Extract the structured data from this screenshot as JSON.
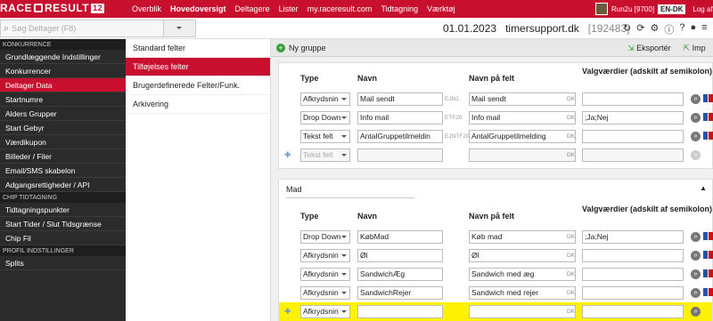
{
  "app": {
    "logo_text": "RACE",
    "logo_result": "RESULT",
    "logo_num": "12"
  },
  "nav": {
    "items": [
      "Overblik",
      "Hovedoversigt",
      "Deltagere",
      "Lister",
      "my.raceresult.com",
      "Tidtagning",
      "Værktøj"
    ],
    "active": "Hovedoversigt"
  },
  "user": {
    "name": "Run2u [9700]",
    "lang": "EN-DK",
    "logout": "Log af"
  },
  "search": {
    "placeholder": "Søg Deltager (F8)"
  },
  "event": {
    "date": "01.01.2023",
    "name": "timersupport.dk",
    "id": "[192483]"
  },
  "sidebar": {
    "sections": [
      {
        "title": "KONKURRENCE",
        "items": [
          "Grundlæggende Indstillinger",
          "Konkurrencer",
          "Deltager Data",
          "Startnumre",
          "Alders Grupper",
          "Start Gebyr",
          "Værdikupon",
          "Billeder / Filer",
          "Email/SMS skabelon",
          "Adgangsrettigheder / API"
        ]
      },
      {
        "title": "CHIP TIDTAGNING",
        "items": [
          "Tidtagningspunkter",
          "Start Tider / Slut Tidsgrænse",
          "Chip Fil"
        ]
      },
      {
        "title": "PROFIL INDSTILLINGER",
        "items": [
          "Splits"
        ]
      }
    ],
    "active": "Deltager Data"
  },
  "midmenu": {
    "items": [
      "Standard felter",
      "Tilføjelses felter",
      "Brugerdefinerede Felter/Funk.",
      "Arkivering"
    ],
    "active": "Tilføjelses felter"
  },
  "toolbar": {
    "new_group": "Ny gruppe",
    "export": "Eksportér",
    "import": "Imp"
  },
  "columns": {
    "type": "Type",
    "name": "Navn",
    "field_name": "Navn på felt",
    "values": "Valgværdier (adskilt af semikolon)"
  },
  "dk_label": "DK",
  "groups": [
    {
      "title": "",
      "rows": [
        {
          "type": "Afkrydsnin",
          "name": "Mail sendt",
          "code": "EJN1",
          "field": "Mail sendt",
          "values": ""
        },
        {
          "type": "Drop Down",
          "name": "Info mail",
          "code": "ETF20",
          "field": "Info mail",
          "values": ";Ja;Nej"
        },
        {
          "type": "Tekst felt",
          "name": "AntalGruppetilmeldin",
          "code": "EJNTF20",
          "field": "AntalGruppetilmelding",
          "values": ""
        },
        {
          "type": "Tekst felt",
          "name": "",
          "code": "",
          "field": "",
          "values": "",
          "disabled": true
        }
      ]
    },
    {
      "title": "Mad",
      "rows": [
        {
          "type": "Drop Down",
          "name": "KøbMad",
          "code": "",
          "field": "Køb mad",
          "values": ";Ja;Nej"
        },
        {
          "type": "Afkrydsnin",
          "name": "Øl",
          "code": "",
          "field": "Øl",
          "values": ""
        },
        {
          "type": "Afkrydsnin",
          "name": "SandwichÆg",
          "code": "",
          "field": "Sandwich med æg",
          "values": ""
        },
        {
          "type": "Afkrydsnin",
          "name": "SandwichRejer",
          "code": "",
          "field": "Sandwich med rejer",
          "values": ""
        },
        {
          "type": "Afkrydsnin",
          "name": "",
          "code": "",
          "field": "",
          "values": "",
          "highlight": true
        }
      ]
    }
  ]
}
